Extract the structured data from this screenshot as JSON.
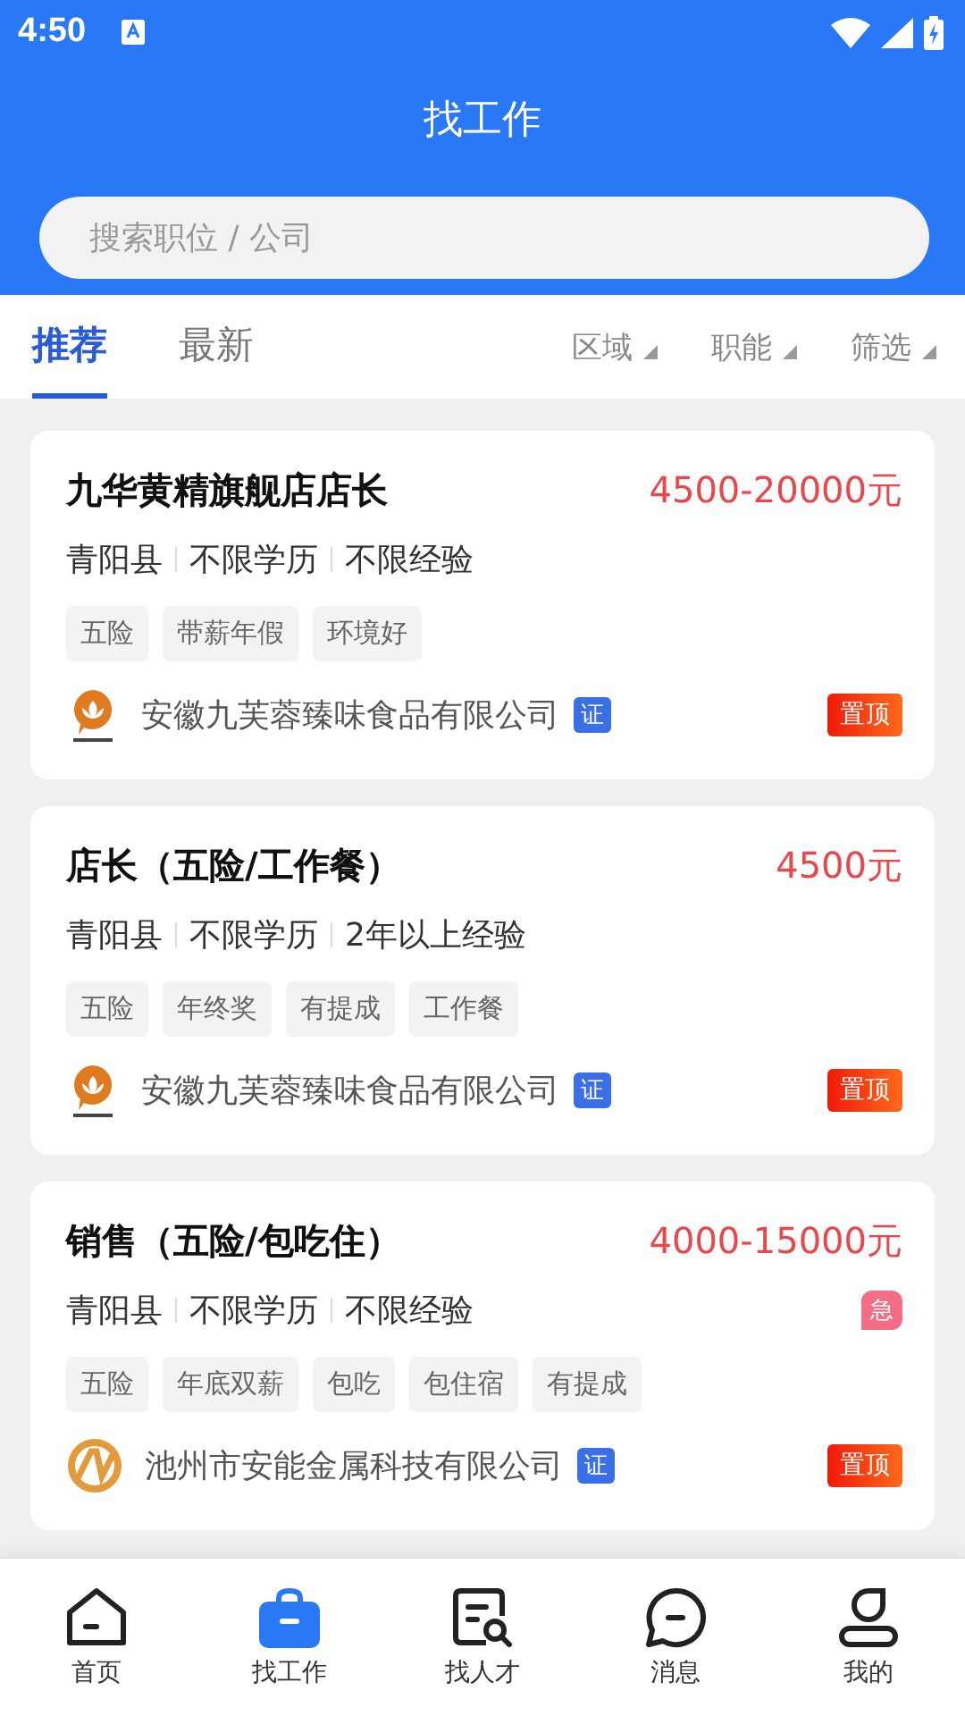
{
  "status_bar": {
    "time": "4:50"
  },
  "header": {
    "title": "找工作"
  },
  "search": {
    "placeholder": "搜索职位 / 公司"
  },
  "tabs": [
    {
      "label": "推荐",
      "selected": true
    },
    {
      "label": "最新",
      "selected": false
    }
  ],
  "filters": [
    "区域",
    "职能",
    "筛选"
  ],
  "jobs": [
    {
      "title": "九华黄精旗舰店店长",
      "salary": "4500-20000元",
      "meta": [
        "青阳县",
        "不限学历",
        "不限经验"
      ],
      "urgent": false,
      "tags": [
        "五险",
        "带薪年假",
        "环境好"
      ],
      "logo": {
        "kind": "lotus"
      },
      "company": "安徽九芙蓉臻味食品有限公司",
      "verified": "证",
      "pinned": "置顶"
    },
    {
      "title": "店长（五险/工作餐）",
      "salary": "4500元",
      "meta": [
        "青阳县",
        "不限学历",
        "2年以上经验"
      ],
      "urgent": false,
      "tags": [
        "五险",
        "年终奖",
        "有提成",
        "工作餐"
      ],
      "logo": {
        "kind": "lotus"
      },
      "company": "安徽九芙蓉臻味食品有限公司",
      "verified": "证",
      "pinned": "置顶"
    },
    {
      "title": "销售（五险/包吃住）",
      "salary": "4000-15000元",
      "meta": [
        "青阳县",
        "不限学历",
        "不限经验"
      ],
      "urgent": "急",
      "tags": [
        "五险",
        "年底双薪",
        "包吃",
        "包住宿",
        "有提成"
      ],
      "logo": {
        "kind": "ring"
      },
      "company": "池州市安能金属科技有限公司",
      "verified": "证",
      "pinned": "置顶"
    }
  ],
  "nav": [
    {
      "label": "首页",
      "kind": "home",
      "selected": false
    },
    {
      "label": "找工作",
      "kind": "bag",
      "selected": true
    },
    {
      "label": "找人才",
      "kind": "doc",
      "selected": false
    },
    {
      "label": "消息",
      "kind": "chat",
      "selected": false
    },
    {
      "label": "我的",
      "kind": "user",
      "selected": false
    }
  ]
}
